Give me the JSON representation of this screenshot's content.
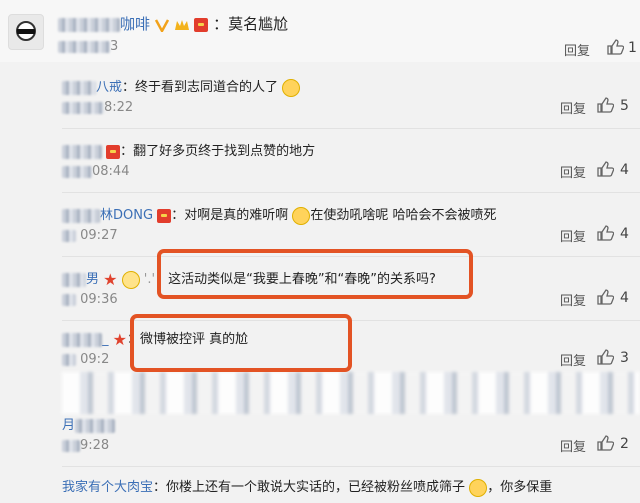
{
  "top": {
    "username": "咖啡",
    "comment": "莫名尴尬",
    "time_suffix": "3",
    "reply": "回复",
    "likes": "1"
  },
  "replies": [
    {
      "user": "八戒",
      "text": "终于看到志同道合的人了",
      "time": "8:22",
      "reply": "回复",
      "likes": "5"
    },
    {
      "user": "",
      "text": "翻了好多页终于找到点赞的地方",
      "time": "08:44",
      "reply": "回复",
      "likes": "4"
    },
    {
      "user": "林DONG",
      "text_before": "对啊是真的难听啊",
      "text_after": "在使劲吼啥呢 哈哈会不会被喷死",
      "time": "09:27",
      "reply": "回复",
      "likes": "4"
    },
    {
      "user": "男",
      "text": "这活动类似是“我要上春晚”和“春晚”的关系吗?",
      "time": "09:36",
      "reply": "回复",
      "likes": "4"
    },
    {
      "user": "_",
      "text": "微博被控评 真的尬",
      "time": "09:2",
      "reply": "回复",
      "likes": "3"
    },
    {
      "user": "月",
      "text": "",
      "time": "9:28",
      "reply": "回复",
      "likes": "2"
    },
    {
      "user": "我家有个大肉宝",
      "text": "你楼上还有一个敢说大实话的，已经被粉丝喷成筛子",
      "text_after": "，你多保重"
    }
  ],
  "colors": {
    "highlight_box": "#e35324",
    "username_blue": "#3b6fb6"
  }
}
